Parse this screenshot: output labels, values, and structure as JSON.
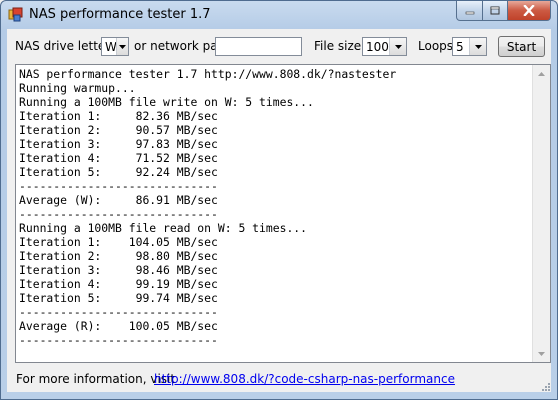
{
  "window": {
    "title": "NAS performance tester 1.7"
  },
  "toolbar": {
    "drive_label": "NAS drive letter",
    "drive_value": "W",
    "or_label": "or network path",
    "network_path_value": "",
    "filesize_label": "File size",
    "filesize_value": "100",
    "loops_label": "Loops",
    "loops_value": "5",
    "start_label": "Start"
  },
  "output": {
    "lines": [
      "NAS performance tester 1.7 http://www.808.dk/?nastester",
      "Running warmup...",
      "Running a 100MB file write on W: 5 times...",
      "Iteration 1:     82.36 MB/sec",
      "Iteration 2:     90.57 MB/sec",
      "Iteration 3:     97.83 MB/sec",
      "Iteration 4:     71.52 MB/sec",
      "Iteration 5:     92.24 MB/sec",
      "-----------------------------",
      "Average (W):     86.91 MB/sec",
      "-----------------------------",
      "Running a 100MB file read on W: 5 times...",
      "Iteration 1:    104.05 MB/sec",
      "Iteration 2:     98.80 MB/sec",
      "Iteration 3:     98.46 MB/sec",
      "Iteration 4:     99.19 MB/sec",
      "Iteration 5:     99.74 MB/sec",
      "-----------------------------",
      "Average (R):    100.05 MB/sec",
      "-----------------------------"
    ]
  },
  "footer": {
    "text": "For more information, visit",
    "link": "http://www.808.dk/?code-csharp-nas-performance"
  },
  "icons": {
    "app": "app-icon",
    "minimize": "minimize-icon",
    "maximize": "maximize-icon",
    "close": "close-icon",
    "dropdown": "chevron-down-icon",
    "scroll_up": "scroll-up-icon",
    "scroll_down": "scroll-down-icon",
    "resize_grip": "resize-grip-icon"
  },
  "colors": {
    "title_bar": "#b9cfe8",
    "close_button": "#c0422a",
    "link": "#0000ee",
    "window_background": "#f0f0f0"
  }
}
